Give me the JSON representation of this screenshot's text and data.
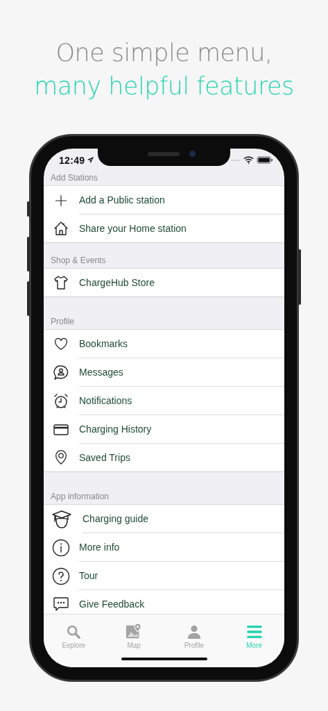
{
  "headline": {
    "line_1": "One simple menu,",
    "line_2": "many helpful features"
  },
  "status_bar": {
    "time": "12:49"
  },
  "sections": [
    {
      "title": "Add Stations",
      "items": [
        {
          "label": "Add a Public station",
          "kind": "plus"
        },
        {
          "label": "Share your Home station",
          "kind": "house"
        }
      ]
    },
    {
      "title": "Shop & Events",
      "items": [
        {
          "label": "ChargeHub Store",
          "kind": "shirt"
        }
      ]
    },
    {
      "title": "Profile",
      "items": [
        {
          "label": "Bookmarks",
          "kind": "heart"
        },
        {
          "label": "Messages",
          "kind": "message"
        },
        {
          "label": "Notifications",
          "kind": "alarm"
        },
        {
          "label": "Charging History",
          "kind": "card"
        },
        {
          "label": "Saved Trips",
          "kind": "pin"
        }
      ]
    },
    {
      "title": "App information",
      "items": [
        {
          "label": "Charging guide",
          "kind": "cap"
        },
        {
          "label": "More info",
          "kind": "info"
        },
        {
          "label": "Tour",
          "kind": "question"
        },
        {
          "label": "Give Feedback",
          "kind": "feedback"
        }
      ]
    }
  ],
  "tabs": [
    {
      "label": "Explore",
      "kind": "search",
      "selected": false
    },
    {
      "label": "Map",
      "kind": "map",
      "selected": false
    },
    {
      "label": "Profile",
      "kind": "person",
      "selected": false
    },
    {
      "label": "More",
      "kind": "menu",
      "selected": true
    }
  ]
}
